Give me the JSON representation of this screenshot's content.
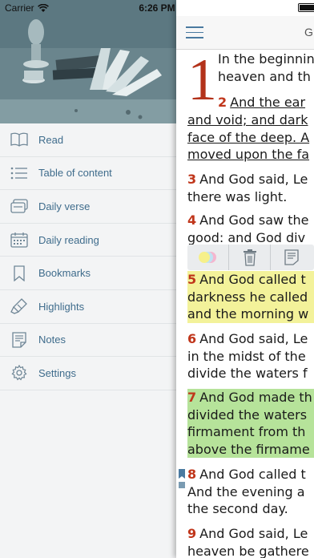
{
  "status": {
    "carrier": "Carrier",
    "time": "6:26 PM"
  },
  "sidebar": {
    "items": [
      {
        "label": "Read",
        "icon": "book-open-icon"
      },
      {
        "label": "Table of content",
        "icon": "list-icon"
      },
      {
        "label": "Daily verse",
        "icon": "cards-icon"
      },
      {
        "label": "Daily reading",
        "icon": "calendar-icon"
      },
      {
        "label": "Bookmarks",
        "icon": "bookmark-icon"
      },
      {
        "label": "Highlights",
        "icon": "highlighter-icon"
      },
      {
        "label": "Notes",
        "icon": "note-icon"
      },
      {
        "label": "Settings",
        "icon": "gear-icon"
      }
    ]
  },
  "reader": {
    "title": "G",
    "drop_cap": "1",
    "lines": [
      {
        "num": "",
        "text": "In the beginnin"
      },
      {
        "num": "",
        "text": "heaven and th"
      },
      {
        "num": "2",
        "text": "And the ear"
      },
      {
        "num": "",
        "text": "and void; and dark"
      },
      {
        "num": "",
        "text": "face of the deep. A"
      },
      {
        "num": "",
        "text": "moved upon the fa"
      },
      {
        "num": "3",
        "text": "And God said, Le"
      },
      {
        "num": "",
        "text": "there was light."
      },
      {
        "num": "4",
        "text": "And God saw the"
      },
      {
        "num": "",
        "text": "good: and God div"
      },
      {
        "num": "5",
        "text": "And God called t"
      },
      {
        "num": "",
        "text": "darkness he called"
      },
      {
        "num": "",
        "text": "and the morning w"
      },
      {
        "num": "6",
        "text": "And God said, Le"
      },
      {
        "num": "",
        "text": "in the midst of the"
      },
      {
        "num": "",
        "text": "divide the waters f"
      },
      {
        "num": "7",
        "text": "And God made th"
      },
      {
        "num": "",
        "text": "divided the waters"
      },
      {
        "num": "",
        "text": "firmament from th"
      },
      {
        "num": "",
        "text": "above the firmame"
      },
      {
        "num": "8",
        "text": "And God called t"
      },
      {
        "num": "",
        "text": "And the evening a"
      },
      {
        "num": "",
        "text": "the second day."
      },
      {
        "num": "9",
        "text": "And God said, Le"
      },
      {
        "num": "",
        "text": "heaven be gathere"
      }
    ]
  },
  "colors": {
    "accent": "#3f6c8c",
    "verse_number": "#c0361b",
    "highlight_yellow": "#f3f29a",
    "highlight_green": "#b6e39a"
  }
}
